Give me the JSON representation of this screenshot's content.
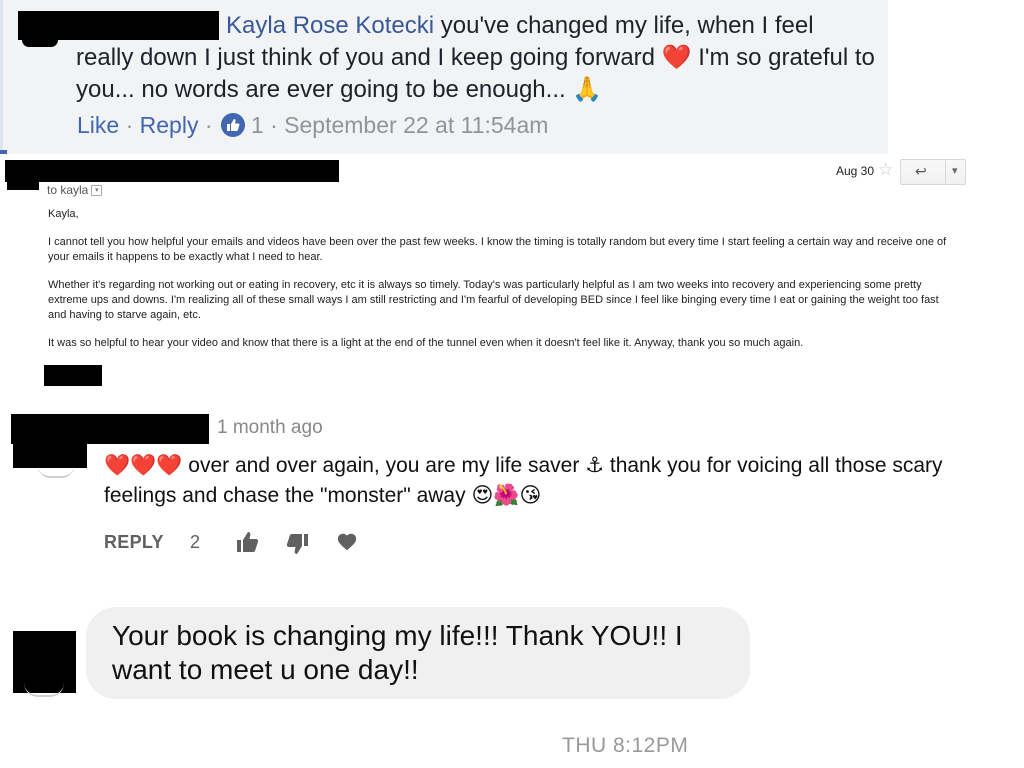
{
  "facebook_comment": {
    "author": "Kayla Rose Kotecki",
    "text_part1": "you've changed my life, when I feel really down I just think of you and I keep going forward",
    "emoji_heart": "❤️",
    "text_part2": "I'm so grateful to you... no words are ever going to be enough...",
    "emoji_pray": "🙏",
    "like_label": "Like",
    "separator": "·",
    "reply_label": "Reply",
    "like_count": "1",
    "timestamp": "September 22 at 11:54am"
  },
  "email": {
    "date": "Aug 30",
    "star_icon": "☆",
    "reply_icon": "↩",
    "more_icon": "▾",
    "to_line": "to kayla",
    "greeting": "Kayla,",
    "paragraphs": [
      "I cannot tell you how helpful your emails and videos have been over the past few weeks. I know the timing is totally random but every time I start feeling a certain way and receive one of your emails it happens to be exactly what I need to hear.",
      "Whether it's regarding not working out or eating in recovery, etc it is always so timely. Today's was particularly helpful as I am two weeks into recovery and experiencing some pretty extreme ups and downs. I'm realizing all of these small ways I am still restricting and I'm fearful of developing BED since I feel like binging every time I eat or gaining the weight too fast and having to starve again, etc.",
      "It was so helpful to hear your video and know that there is a light at the end of the tunnel even when it doesn't feel like it. Anyway, thank you so much again."
    ]
  },
  "youtube_comment": {
    "time_ago": "1 month ago",
    "emoji_hearts": "❤️❤️❤️",
    "text_part1": "over and over again, you are my life saver",
    "emoji_anchor": "⚓",
    "text_part2": "thank you for voicing all those scary feelings and chase the \"monster\" away",
    "emoji_end": "😍🌺😘",
    "reply_label": "REPLY",
    "like_count": "2"
  },
  "messenger": {
    "message": "Your book is changing my life!!! Thank YOU!! I want to meet u one day!!",
    "timestamp": "THU 8:12PM"
  },
  "colors": {
    "facebook_blue": "#4267b2",
    "facebook_author": "#385898",
    "redaction": "#000000",
    "bubble": "#f1f0f0"
  }
}
